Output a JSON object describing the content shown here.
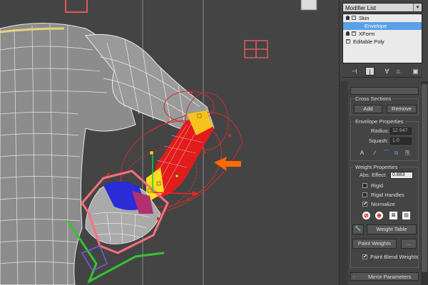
{
  "modifier_list": {
    "label": "Modifier List",
    "arrow": "▾"
  },
  "stack": {
    "items": [
      {
        "label": "Skin",
        "indent": 0,
        "selected": false,
        "box": "−"
      },
      {
        "label": "Envelope",
        "indent": 1,
        "selected": true,
        "box": ""
      },
      {
        "label": "XForm",
        "indent": 0,
        "selected": false,
        "box": "+"
      },
      {
        "label": "Editable Poly",
        "indent": 0,
        "selected": false,
        "box": "+"
      }
    ]
  },
  "toolbar": {
    "icons": [
      "pin-stack-icon",
      "show-end-result-icon",
      "make-unique-icon",
      "remove-modifier-icon",
      "configure-sets-icon"
    ]
  },
  "cross_sections": {
    "title": "Cross Sections",
    "add": "Add",
    "remove": "Remove"
  },
  "envelope_properties": {
    "title": "Envelope Properties",
    "radius_label": "Radius:",
    "radius_value": "12.947",
    "squash_label": "Squash:",
    "squash_value": "1.0"
  },
  "weight_properties": {
    "title": "Weight Properties",
    "abs_effect_label": "Abs. Effect:",
    "abs_effect_value": "0.883",
    "rigid": {
      "label": "Rigid",
      "checked": false
    },
    "rigid_handles": {
      "label": "Rigid Handles",
      "checked": false
    },
    "normalize": {
      "label": "Normalize",
      "checked": true,
      "mark": "✔"
    },
    "weight_table": "Weight Table",
    "paint_weights": "Paint Weights",
    "paint_options": "...",
    "paint_blend": {
      "label": "Paint Blend Weights",
      "checked": true,
      "mark": "✔"
    }
  },
  "mirror_parameters": {
    "title": "Mirror Parameters"
  },
  "colors": {
    "selection": "#5aa0e6",
    "arrow": "#ff6a00",
    "envelope": "#c83030",
    "gizmo": "#ff6677"
  }
}
